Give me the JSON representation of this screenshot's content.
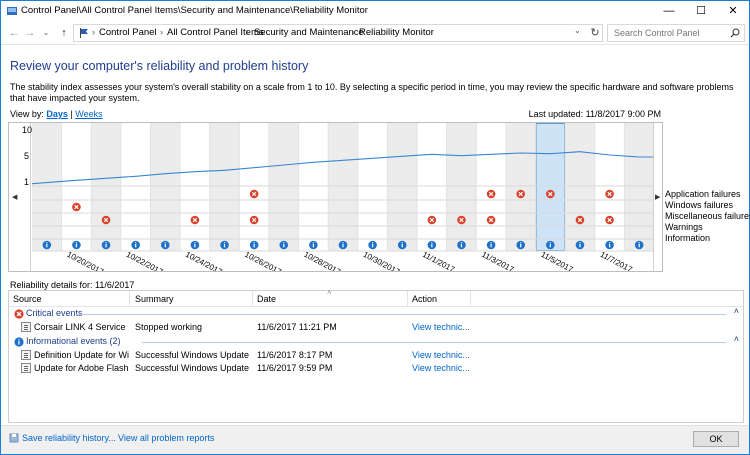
{
  "window": {
    "title": "Control Panel\\All Control Panel Items\\Security and Maintenance\\Reliability Monitor",
    "minimize": "—",
    "maximize": "☐",
    "close": "✕"
  },
  "address": {
    "breadcrumbs": [
      "Control Panel",
      "All Control Panel Items",
      "Security and Maintenance",
      "Reliability Monitor"
    ],
    "search_placeholder": "Search Control Panel"
  },
  "page": {
    "heading": "Review your computer's reliability and problem history",
    "description": "The stability index assesses your system's overall stability on a scale from 1 to 10. By selecting a specific period in time, you may review the specific hardware and software problems that have impacted your system.",
    "view_by_label": "View by:",
    "view_days": "Days",
    "view_sep": " | ",
    "view_weeks": "Weeks",
    "last_updated": "Last updated: 11/8/2017 9:00 PM"
  },
  "chart": {
    "y_ticks": [
      "10",
      "5",
      "1"
    ],
    "row_labels": [
      "Application failures",
      "Windows failures",
      "Miscellaneous failures",
      "Warnings",
      "Information"
    ],
    "date_labels": [
      "10/20/2017",
      "10/22/2017",
      "10/24/2017",
      "10/26/2017",
      "10/28/2017",
      "10/30/2017",
      "11/1/2017",
      "11/3/2017",
      "11/5/2017",
      "11/7/2017"
    ],
    "colors": {
      "line": "#3a86d4",
      "error": "#d9412a",
      "info": "#1f72c9",
      "shade": "#ececec",
      "selected": "#cfe3f7"
    }
  },
  "chart_data": {
    "type": "line",
    "title": "",
    "xlabel": "",
    "ylabel": "",
    "ylim": [
      1,
      10
    ],
    "selected_day_index": 17,
    "days": [
      "10/19",
      "10/20",
      "10/21",
      "10/22",
      "10/23",
      "10/24",
      "10/25",
      "10/26",
      "10/27",
      "10/28",
      "10/29",
      "10/30",
      "10/31",
      "11/1",
      "11/2",
      "11/3",
      "11/4",
      "11/5",
      "11/6",
      "11/7",
      "11/8"
    ],
    "stability_index": [
      1.2,
      1.7,
      2.0,
      2.3,
      2.7,
      3.0,
      3.2,
      3.6,
      4.0,
      4.4,
      4.7,
      5.0,
      5.3,
      5.6,
      5.4,
      5.6,
      5.8,
      5.7,
      6.0,
      5.5,
      5.2
    ],
    "application_failures": [
      0,
      0,
      0,
      0,
      0,
      0,
      0,
      1,
      0,
      0,
      0,
      0,
      0,
      0,
      0,
      1,
      1,
      1,
      0,
      1,
      0
    ],
    "windows_failures": [
      0,
      1,
      0,
      0,
      0,
      0,
      0,
      0,
      0,
      0,
      0,
      0,
      0,
      0,
      0,
      0,
      0,
      0,
      0,
      0,
      0
    ],
    "miscellaneous_failures": [
      0,
      0,
      1,
      0,
      0,
      1,
      0,
      1,
      0,
      0,
      0,
      0,
      0,
      1,
      1,
      1,
      0,
      0,
      1,
      1,
      0
    ],
    "warnings": [
      0,
      0,
      0,
      0,
      0,
      0,
      0,
      0,
      0,
      0,
      0,
      0,
      0,
      0,
      0,
      0,
      0,
      0,
      0,
      0,
      0
    ],
    "information": [
      1,
      1,
      1,
      1,
      1,
      1,
      1,
      1,
      1,
      1,
      1,
      1,
      1,
      1,
      1,
      1,
      1,
      1,
      1,
      1,
      1
    ]
  },
  "details": {
    "label": "Reliability details for: 11/6/2017",
    "columns": [
      "Source",
      "Summary",
      "Date",
      "Action"
    ],
    "critical_group": "Critical events",
    "critical_rows": [
      {
        "source": "Corsair LINK 4 Service",
        "summary": "Stopped working",
        "date": "11/6/2017 11:21 PM",
        "action": "View  technic..."
      }
    ],
    "info_group": "Informational events (2)",
    "info_rows": [
      {
        "source": "Definition Update for Win...",
        "summary": "Successful Windows Update",
        "date": "11/6/2017 8:17 PM",
        "action": "View  technic..."
      },
      {
        "source": "Update for Adobe Flash P...",
        "summary": "Successful Windows Update",
        "date": "11/6/2017 9:59 PM",
        "action": "View  technic..."
      }
    ]
  },
  "footer": {
    "save_history": "Save reliability history...",
    "view_all": "View all problem reports",
    "ok": "OK"
  }
}
